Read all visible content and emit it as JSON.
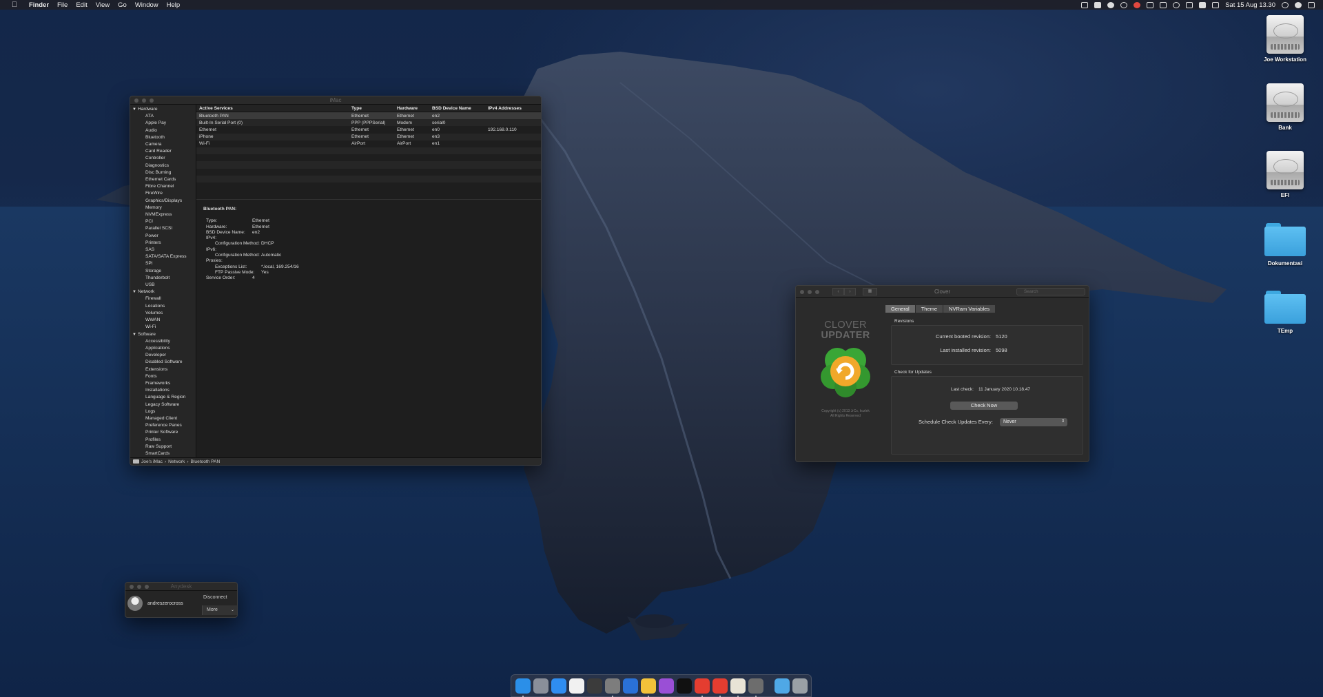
{
  "menubar": {
    "app_name": "Finder",
    "menus": [
      "File",
      "Edit",
      "View",
      "Go",
      "Window",
      "Help"
    ],
    "status_icons": [
      "display-icon",
      "dropbox-icon",
      "cloud-icon",
      "gear-icon",
      "s-app-icon",
      "bluetooth-icon",
      "keyboard-icon",
      "wifi-icon",
      "airplay-icon",
      "eject-icon",
      "volume-icon"
    ],
    "clock": "Sat 15 Aug  13.30"
  },
  "desktop": {
    "icons": [
      {
        "label": "Joe Workstation",
        "kind": "disk"
      },
      {
        "label": "Bank",
        "kind": "disk"
      },
      {
        "label": "EFI",
        "kind": "disk"
      },
      {
        "label": "Dokumentasi",
        "kind": "folder"
      },
      {
        "label": "TEmp",
        "kind": "folder"
      }
    ]
  },
  "sysinfo": {
    "title": "iMac",
    "sidebar": [
      {
        "group": "Hardware",
        "items": [
          "ATA",
          "Apple Pay",
          "Audio",
          "Bluetooth",
          "Camera",
          "Card Reader",
          "Controller",
          "Diagnostics",
          "Disc Burning",
          "Ethernet Cards",
          "Fibre Channel",
          "FireWire",
          "Graphics/Displays",
          "Memory",
          "NVMExpress",
          "PCI",
          "Parallel SCSI",
          "Power",
          "Printers",
          "SAS",
          "SATA/SATA Express",
          "SPI",
          "Storage",
          "Thunderbolt",
          "USB"
        ]
      },
      {
        "group": "Network",
        "items": [
          "Firewall",
          "Locations",
          "Volumes",
          "WWAN",
          "Wi-Fi"
        ]
      },
      {
        "group": "Software",
        "items": [
          "Accessibility",
          "Applications",
          "Developer",
          "Disabled Software",
          "Extensions",
          "Fonts",
          "Frameworks",
          "Installations",
          "Language & Region",
          "Legacy Software",
          "Logs",
          "Managed Client",
          "Preference Panes",
          "Printer Software",
          "Profiles",
          "Raw Support",
          "SmartCards"
        ]
      }
    ],
    "table": {
      "headers": [
        "Active Services",
        "Type",
        "Hardware",
        "BSD Device Name",
        "IPv4 Addresses"
      ],
      "rows": [
        [
          "Bluetooth PAN",
          "Ethernet",
          "Ethernet",
          "en2",
          ""
        ],
        [
          "Built-In Serial Port (0)",
          "PPP (PPPSerial)",
          "Modem",
          "serial0",
          ""
        ],
        [
          "Ethernet",
          "Ethernet",
          "Ethernet",
          "en0",
          "192.168.0.110"
        ],
        [
          "iPhone",
          "Ethernet",
          "Ethernet",
          "en3",
          ""
        ],
        [
          "Wi-Fi",
          "AirPort",
          "AirPort",
          "en1",
          ""
        ]
      ]
    },
    "detail": {
      "title": "Bluetooth PAN:",
      "lines": [
        {
          "key": "Type:",
          "value": "Ethernet",
          "indent": 0
        },
        {
          "key": "Hardware:",
          "value": "Ethernet",
          "indent": 0
        },
        {
          "key": "BSD Device Name:",
          "value": "en2",
          "indent": 0
        },
        {
          "key": "IPv4:",
          "value": "",
          "indent": 0
        },
        {
          "key": "Configuration Method:",
          "value": "DHCP",
          "indent": 1
        },
        {
          "key": "IPv6:",
          "value": "",
          "indent": 0
        },
        {
          "key": "Configuration Method:",
          "value": "Automatic",
          "indent": 1
        },
        {
          "key": "Proxies:",
          "value": "",
          "indent": 0
        },
        {
          "key": "Exceptions List:",
          "value": "*.local, 169.254/16",
          "indent": 1
        },
        {
          "key": "FTP Passive Mode:",
          "value": "Yes",
          "indent": 1
        },
        {
          "key": "Service Order:",
          "value": "4",
          "indent": 0
        }
      ]
    },
    "breadcrumb": [
      "Joe's iMac",
      "Network",
      "Bluetooth PAN"
    ]
  },
  "clover": {
    "title": "Clover",
    "search_placeholder": "Search",
    "tabs": [
      "General",
      "Theme",
      "NVRam Variables"
    ],
    "active_tab": "General",
    "logo_line1": "CLOVER",
    "logo_line2": "UPDATER",
    "copyright_line1": "Copyright (c) 2013 JrCs, kozlek",
    "copyright_line2": "All Rights Reserved",
    "revisions_label": "Revisions",
    "current_label": "Current booted revision:",
    "current_value": "5120",
    "installed_label": "Last installed revision:",
    "installed_value": "5098",
    "check_label": "Check for Updates",
    "last_check_label": "Last check:",
    "last_check_value": "11 January 2020 10.18.47",
    "check_now": "Check Now",
    "schedule_label": "Schedule Check Updates Every:",
    "schedule_value": "Never"
  },
  "anydesk": {
    "title": "Anydesk",
    "username": "andreszerocross",
    "disconnect": "Disconnect",
    "more": "More"
  },
  "dock": {
    "apps": [
      {
        "name": "finder",
        "color": "#2b8fe8",
        "running": true
      },
      {
        "name": "launchpad",
        "color": "#8a8f9a",
        "running": false
      },
      {
        "name": "safari",
        "color": "#2f8df0",
        "running": false
      },
      {
        "name": "calendar",
        "color": "#f1f1f1",
        "running": false
      },
      {
        "name": "final-cut",
        "color": "#3b3b3b",
        "running": false
      },
      {
        "name": "system-preferences",
        "color": "#7d7d7d",
        "running": true
      },
      {
        "name": "app-store",
        "color": "#2a71d6",
        "running": false
      },
      {
        "name": "chrome",
        "color": "#f2c23a",
        "running": true
      },
      {
        "name": "podcasts",
        "color": "#9a4fd6",
        "running": false
      },
      {
        "name": "apple-tv",
        "color": "#111111",
        "running": false
      },
      {
        "name": "anydesk",
        "color": "#e43d30",
        "running": true
      },
      {
        "name": "anydesk-2",
        "color": "#e43d30",
        "running": true
      },
      {
        "name": "preview",
        "color": "#e8e3d6",
        "running": true
      },
      {
        "name": "system-information",
        "color": "#6d6d6d",
        "running": true
      }
    ],
    "trailing": [
      {
        "name": "downloads-folder",
        "color": "#4fa8e6"
      },
      {
        "name": "trash",
        "color": "#9aa0a6"
      }
    ]
  }
}
